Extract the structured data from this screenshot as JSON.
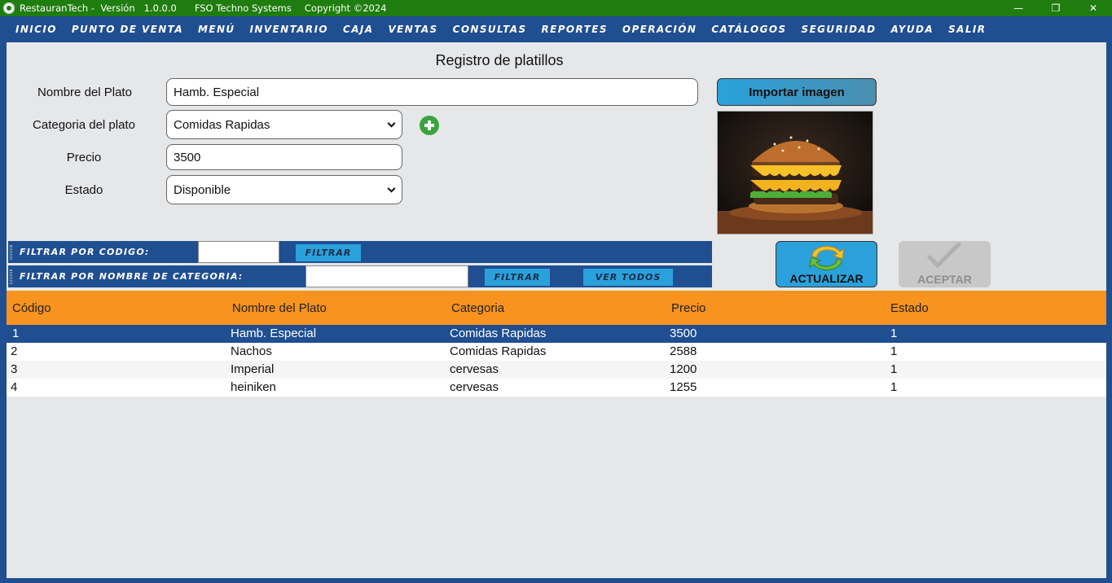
{
  "window": {
    "app_name": "RestauranTech",
    "version_label": "-  Versión   1.0.0.0",
    "company": "FSO Techno Systems",
    "copyright": "Copyright ©2024",
    "minimize": "—",
    "maximize": "❐",
    "close": "✕"
  },
  "menu": [
    "INICIO",
    "PUNTO DE VENTA",
    "MENÚ",
    "INVENTARIO",
    "CAJA",
    "VENTAS",
    "CONSULTAS",
    "REPORTES",
    "OPERACIÓN",
    "CATÁLOGOS",
    "SEGURIDAD",
    "AYUDA",
    "SALIR"
  ],
  "form": {
    "title": "Registro de platillos",
    "name_label": "Nombre del Plato",
    "name_value": "Hamb. Especial",
    "category_label": "Categoria del plato",
    "category_value": "Comidas Rapidas",
    "price_label": "Precio",
    "price_value": "3500",
    "status_label": "Estado",
    "status_value": "Disponible",
    "import_button": "Importar imagen",
    "add_category_icon": "plus-circle-icon"
  },
  "filters": {
    "code_label": "FILTRAR POR CODIGO:",
    "code_value": "",
    "code_button": "FILTRAR",
    "category_label": "FILTRAR POR NOMBRE DE CATEGORIA:",
    "category_value": "",
    "category_button": "FILTRAR",
    "view_all_button": "VER TODOS"
  },
  "actions": {
    "refresh": "ACTUALIZAR",
    "accept": "ACEPTAR"
  },
  "table": {
    "columns": [
      "Código",
      "Nombre del Plato",
      "Categoria",
      "Precio",
      "Estado"
    ],
    "rows": [
      [
        "1",
        "Hamb. Especial",
        "Comidas Rapidas",
        "3500",
        "1"
      ],
      [
        "2",
        "Nachos",
        "Comidas Rapidas",
        "2588",
        "1"
      ],
      [
        "3",
        "Imperial",
        "cervesas",
        "1200",
        "1"
      ],
      [
        "4",
        "heiniken",
        "cervesas",
        "1255",
        "1"
      ]
    ],
    "selected_row": 0
  },
  "colors": {
    "titlebar": "#1f7d0f",
    "menubar": "#1f4e91",
    "accent": "#2aa1db",
    "grid_header": "#f7931e",
    "selected_row": "#1f4e91"
  }
}
